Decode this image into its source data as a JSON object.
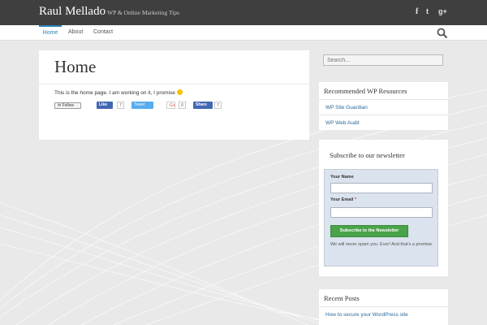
{
  "header": {
    "site_title": "Raul Mellado",
    "tagline": "WP & Online Marketing Tips",
    "social": {
      "facebook": "f",
      "twitter": "t",
      "googleplus": "g+"
    }
  },
  "nav": {
    "items": [
      {
        "label": "Home"
      },
      {
        "label": "About"
      },
      {
        "label": "Contact"
      }
    ]
  },
  "main": {
    "title": "Home",
    "body": "This is the home page. I am working on it, I promise",
    "share": {
      "follow": "Follow",
      "like": "Like",
      "like_count": "7",
      "tweet": "Tweet",
      "gplus": "G+",
      "gplus_count": "0",
      "share": "Share",
      "share_count": "7"
    }
  },
  "sidebar": {
    "search": {
      "placeholder": "Search..."
    },
    "resources": {
      "title": "Recommended WP Resources",
      "items": [
        {
          "label": "WP Site Guardian"
        },
        {
          "label": "WP Web Audit"
        }
      ]
    },
    "newsletter": {
      "title": "Subscribe to our newsletter",
      "name_label": "Your Name",
      "email_label": "Your Email",
      "required_mark": "*",
      "button": "Subscribe to the Newsletter",
      "note": "We will never spam you. Ever! And that's a promise."
    },
    "recent": {
      "title": "Recent Posts",
      "items": [
        {
          "label": "How to secure your WordPress site"
        }
      ]
    }
  },
  "colors": {
    "accent": "#2c7fb8",
    "topbar": "#3f3f3f",
    "subscribe": "#4aa34a"
  }
}
